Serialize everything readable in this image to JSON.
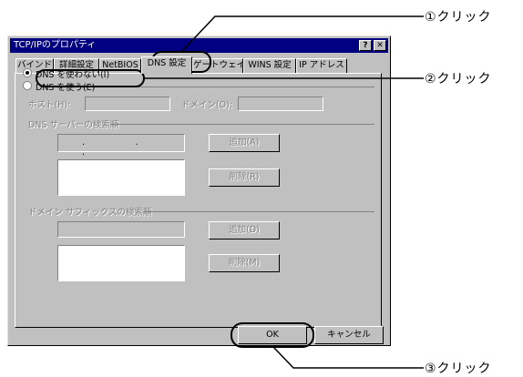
{
  "dialog": {
    "title": "TCP/IPのプロパティ",
    "help_button": "?",
    "close_button": "✕"
  },
  "tabs": [
    "バインド",
    "詳細設定",
    "NetBIOS",
    "DNS 設定",
    "ゲートウェイ",
    "WINS 設定",
    "IP アドレス"
  ],
  "dns": {
    "disable_label": "DNS を使わない(I)",
    "enable_label": "DNS を使う(E)",
    "host_label": "ホスト(H):",
    "domain_label": "ドメイン(O):",
    "server_group": "DNS サーバーの検索順",
    "ip_dots": ".  .  .",
    "add_label": "追加(A)",
    "remove_label": "削除(R)",
    "suffix_group": "ドメイン サフィックスの検索順",
    "add2_label": "追加(D)",
    "remove2_label": "削除(M)"
  },
  "footer": {
    "ok_label": "OK",
    "cancel_label": "キャンセル"
  },
  "callouts": {
    "step1": "①クリック",
    "step2": "②クリック",
    "step3": "③クリック"
  }
}
